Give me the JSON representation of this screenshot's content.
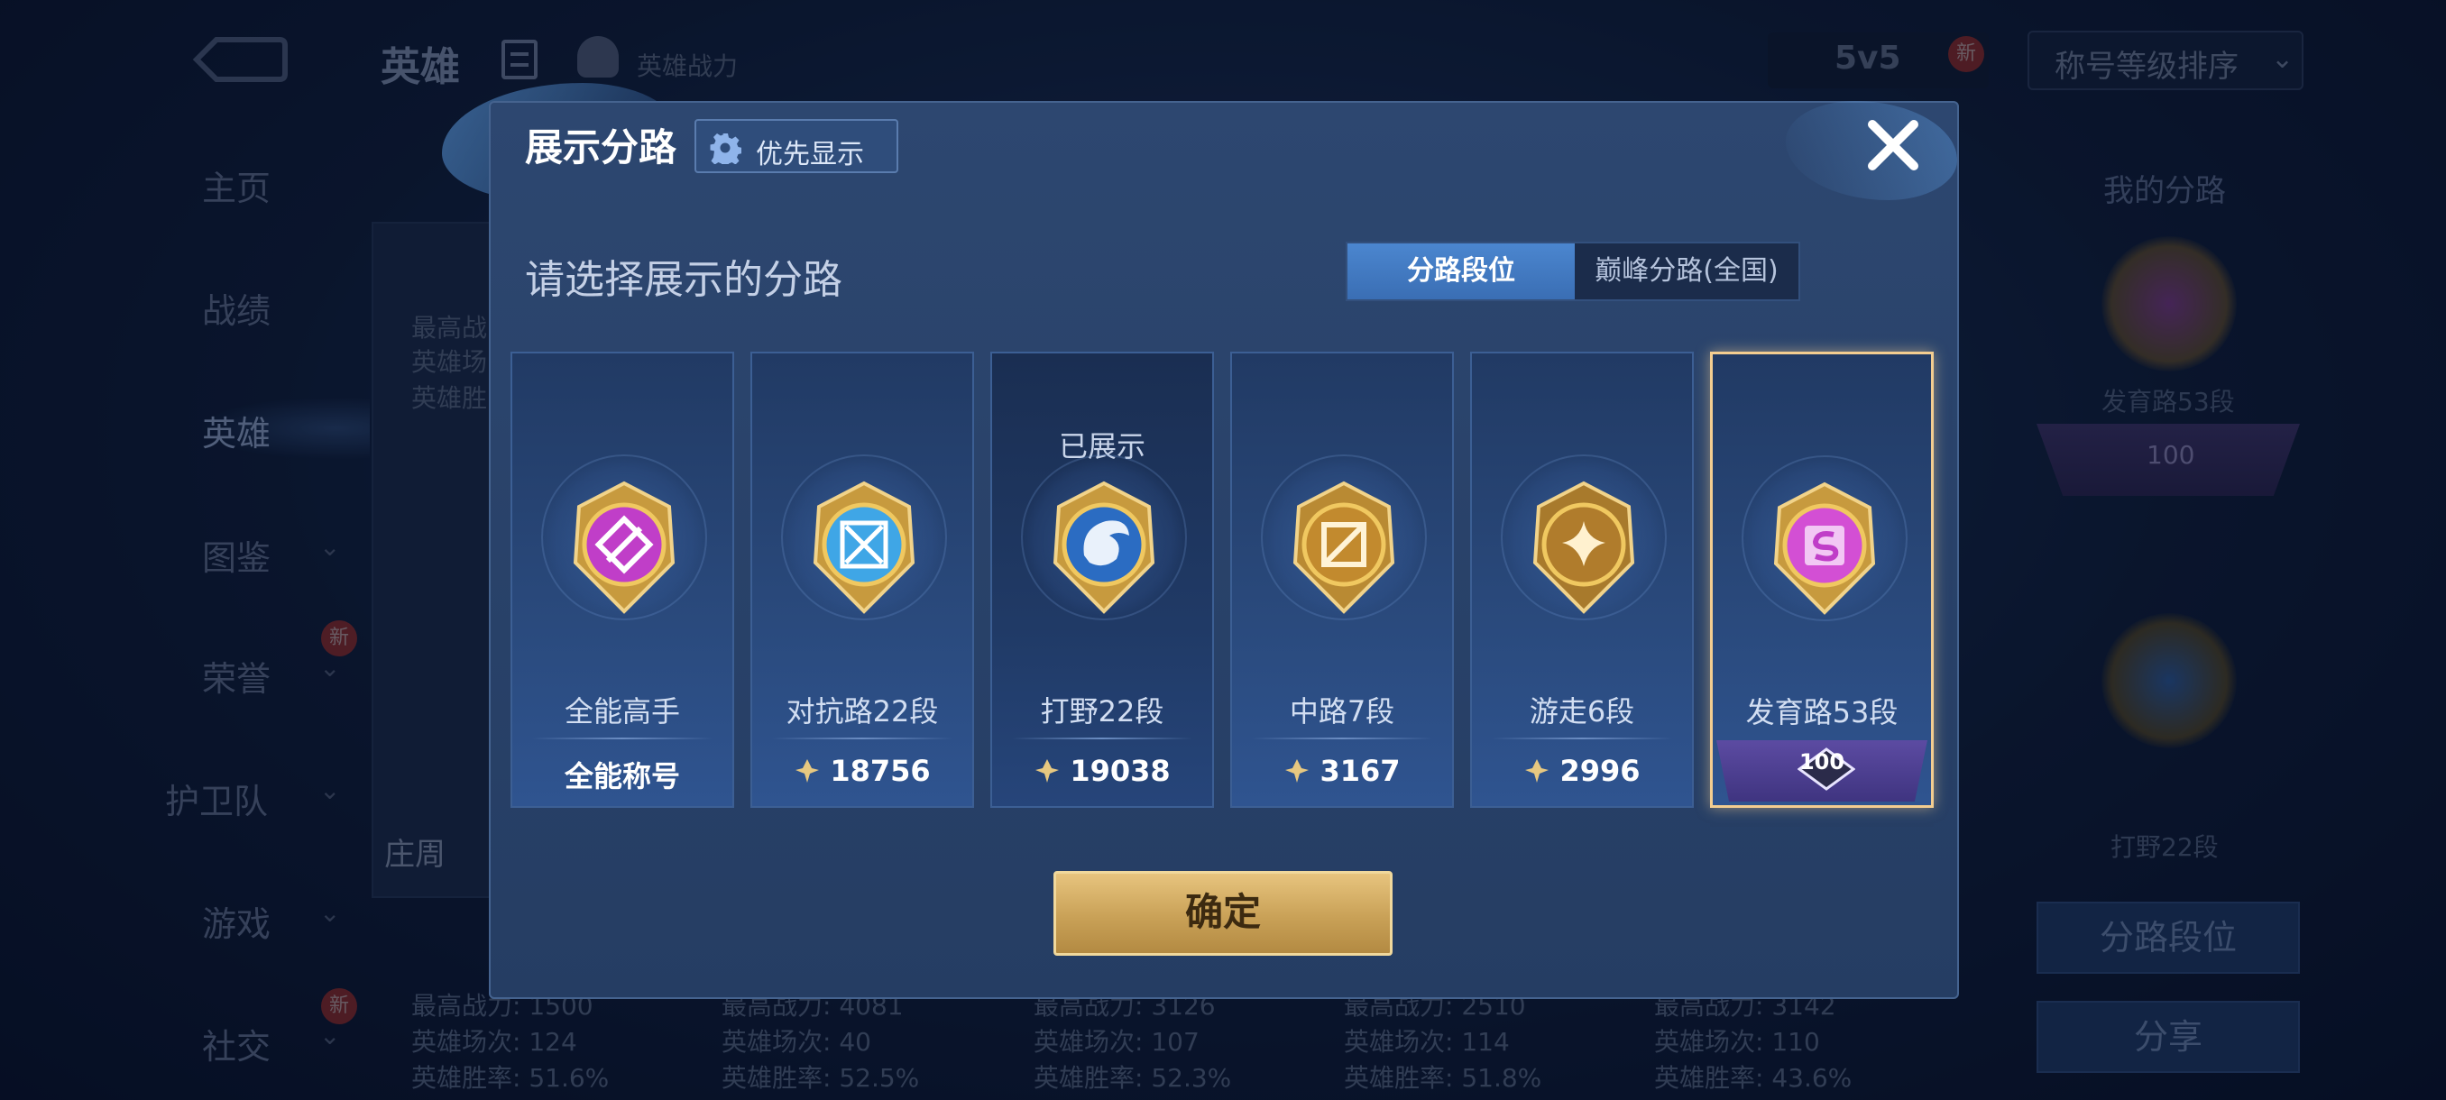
{
  "background": {
    "header": {
      "title": "英雄",
      "power_label": "英雄战力",
      "mode": "5v5",
      "new_badge": "新",
      "sort": "称号等级排序"
    },
    "sidebar": {
      "items": [
        {
          "label": "主页"
        },
        {
          "label": "战绩"
        },
        {
          "label": "英雄"
        },
        {
          "label": "图鉴"
        },
        {
          "label": "荣誉"
        },
        {
          "label": "护卫队"
        },
        {
          "label": "游戏"
        },
        {
          "label": "社交"
        }
      ],
      "new_badge": "新"
    },
    "hero_cards": {
      "top_stats": [
        "最高战",
        "英雄场",
        "英雄胜"
      ],
      "hero_name": "庄周",
      "bottom": [
        {
          "power": "最高战力: 1500",
          "games": "英雄场次: 124",
          "winrate": "英雄胜率: 51.6%"
        },
        {
          "power": "最高战力: 4081",
          "games": "英雄场次: 40",
          "winrate": "英雄胜率: 52.5%"
        },
        {
          "power": "最高战力: 3126",
          "games": "英雄场次: 107",
          "winrate": "英雄胜率: 52.3%"
        },
        {
          "power": "最高战力: 2510",
          "games": "英雄场次: 114",
          "winrate": "英雄胜率: 51.8%"
        },
        {
          "power": "最高战力: 3142",
          "games": "英雄场次: 110",
          "winrate": "英雄胜率: 43.6%"
        }
      ]
    },
    "right_panel": {
      "title": "我的分路",
      "lane1": "发育路53段",
      "lane1_rank": "100",
      "lane2": "打野22段",
      "btn_lane": "分路段位",
      "btn_share": "分享"
    }
  },
  "modal": {
    "title": "展示分路",
    "priority_label": "优先显示",
    "subtitle": "请选择展示的分路",
    "tabs": [
      "分路段位",
      "巅峰分路(全国)"
    ],
    "active_tab": 0,
    "cards": [
      {
        "name": "全能高手",
        "value": "全能称号",
        "has_power_icon": false,
        "shown": false,
        "selected": false,
        "emblem_color": "#c03ec8"
      },
      {
        "name": "对抗路22段",
        "value": "18756",
        "has_power_icon": true,
        "shown": false,
        "selected": false,
        "emblem_color": "#3fa6e6"
      },
      {
        "name": "打野22段",
        "value": "19038",
        "has_power_icon": true,
        "shown": true,
        "shown_label": "已展示",
        "selected": false,
        "emblem_color": "#2b6cc2"
      },
      {
        "name": "中路7段",
        "value": "3167",
        "has_power_icon": true,
        "shown": false,
        "selected": false,
        "emblem_color": "#c28a2e"
      },
      {
        "name": "游走6段",
        "value": "2996",
        "has_power_icon": true,
        "shown": false,
        "selected": false,
        "emblem_color": "#b07c2c"
      },
      {
        "name": "发育路53段",
        "value": "",
        "rank": "100",
        "has_power_icon": false,
        "shown": false,
        "selected": true,
        "emblem_color": "#d34fd4"
      }
    ],
    "confirm_label": "确定"
  }
}
